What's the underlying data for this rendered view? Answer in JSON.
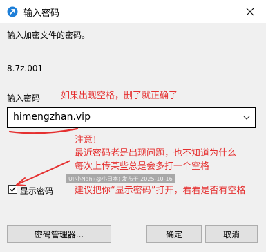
{
  "window": {
    "title": "输入密码",
    "app_icon": "blue-arrow-icon",
    "close_icon": "close-icon"
  },
  "dialog": {
    "prompt": "输入加密文件的密码。",
    "filename": "8.7z.001",
    "password_label": "输入密码",
    "password_value": "himengzhan.vip",
    "show_password_label": "显示密码",
    "show_password_checked": true
  },
  "buttons": {
    "manager": "密码管理器...",
    "ok": "确定",
    "cancel": "取消"
  },
  "annotations": {
    "top_note": "如果出现空格，删了就正确了",
    "lines": [
      "注意！",
      "最近密码老是出现问题，也不知道为什么",
      "每次上传某些总是会多打一个空格",
      "建议把你“显示密码”打开，看看是否有空格"
    ],
    "watermark": "UP小Nahi(@小日本)  发布于 2025-10-16",
    "color": "#e53030"
  }
}
